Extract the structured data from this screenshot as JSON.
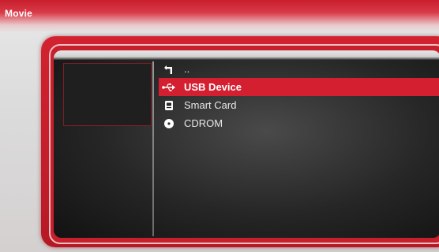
{
  "header": {
    "title": "Movie"
  },
  "browser": {
    "items": [
      {
        "label": "..",
        "icon": "parent-folder-icon",
        "selected": false
      },
      {
        "label": "USB Device",
        "icon": "usb-icon",
        "selected": true
      },
      {
        "label": "Smart Card",
        "icon": "smart-card-icon",
        "selected": false
      },
      {
        "label": "CDROM",
        "icon": "cdrom-icon",
        "selected": false
      }
    ]
  },
  "colors": {
    "accent": "#d41f30",
    "frame": "#c41e2b"
  }
}
